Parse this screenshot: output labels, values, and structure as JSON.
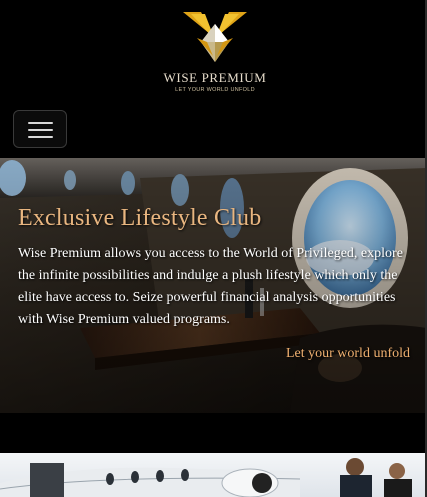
{
  "header": {
    "brand_name": "WISE PREMIUM",
    "brand_tagline": "LET YOUR WORLD UNFOLD",
    "logo_icon": "diamond-crest-icon",
    "menu_icon": "hamburger-menu-icon"
  },
  "hero": {
    "title": "Exclusive Lifestyle Club",
    "body": "Wise Premium allows you access to the World of Privileged, explore the infinite possibilities and indulge a plush lifestyle which only the elite have access to. Seize powerful financial analysis opportunities with Wise Premium valued programs.",
    "link_text": "Let your world unfold"
  },
  "colors": {
    "background": "#000000",
    "gold": "#e9b680",
    "link": "#f0b070",
    "text": "#ffffff"
  }
}
